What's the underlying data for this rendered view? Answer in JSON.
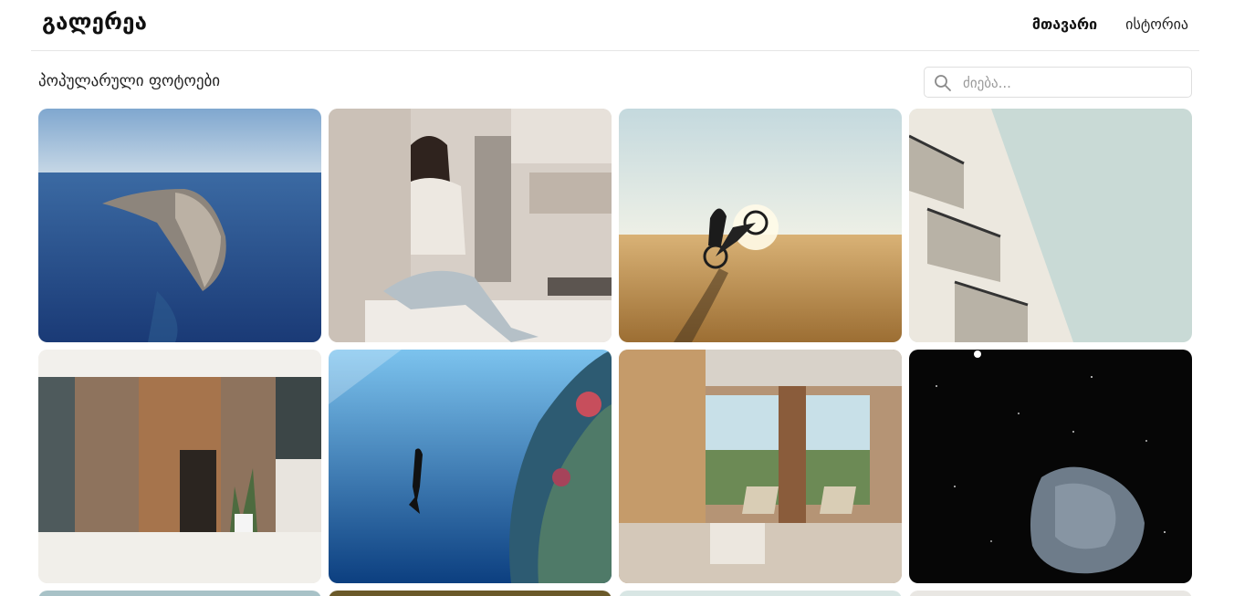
{
  "header": {
    "logo": "გალერეა",
    "nav": [
      {
        "label": "მთავარი",
        "active": true
      },
      {
        "label": "ისტორია",
        "active": false
      }
    ]
  },
  "main": {
    "section_title": "პოპულარული ფოტოები",
    "search": {
      "placeholder": "ძიება...",
      "value": ""
    },
    "photos": [
      {
        "subject": "aerial island in blue sea",
        "colors": [
          "#3d6fa8",
          "#1d3f7a"
        ]
      },
      {
        "subject": "woman sitting in kitchen",
        "colors": [
          "#d9d2cb",
          "#a89a8e"
        ]
      },
      {
        "subject": "motorcycle wheelie on beach at sunset",
        "colors": [
          "#d7e3e3",
          "#b88a4a"
        ]
      },
      {
        "subject": "white building balconies against sky",
        "colors": [
          "#c7d6d3",
          "#e8e4dc"
        ]
      },
      {
        "subject": "stone house entrance with plants",
        "colors": [
          "#9a7b62",
          "#e6e2dc"
        ]
      },
      {
        "subject": "freediver under water near coral reef",
        "colors": [
          "#2f7fc4",
          "#0b3d7e"
        ]
      },
      {
        "subject": "modern interior with chairs by window",
        "colors": [
          "#a98463",
          "#cdd9d8"
        ]
      },
      {
        "subject": "asteroid in starry space",
        "colors": [
          "#0b0b0b",
          "#6c7a87"
        ]
      }
    ],
    "partial_row_colors": [
      "#a8c2c7",
      "#6b5a2a",
      "#d8e6e4",
      "#e9e7e3"
    ]
  }
}
